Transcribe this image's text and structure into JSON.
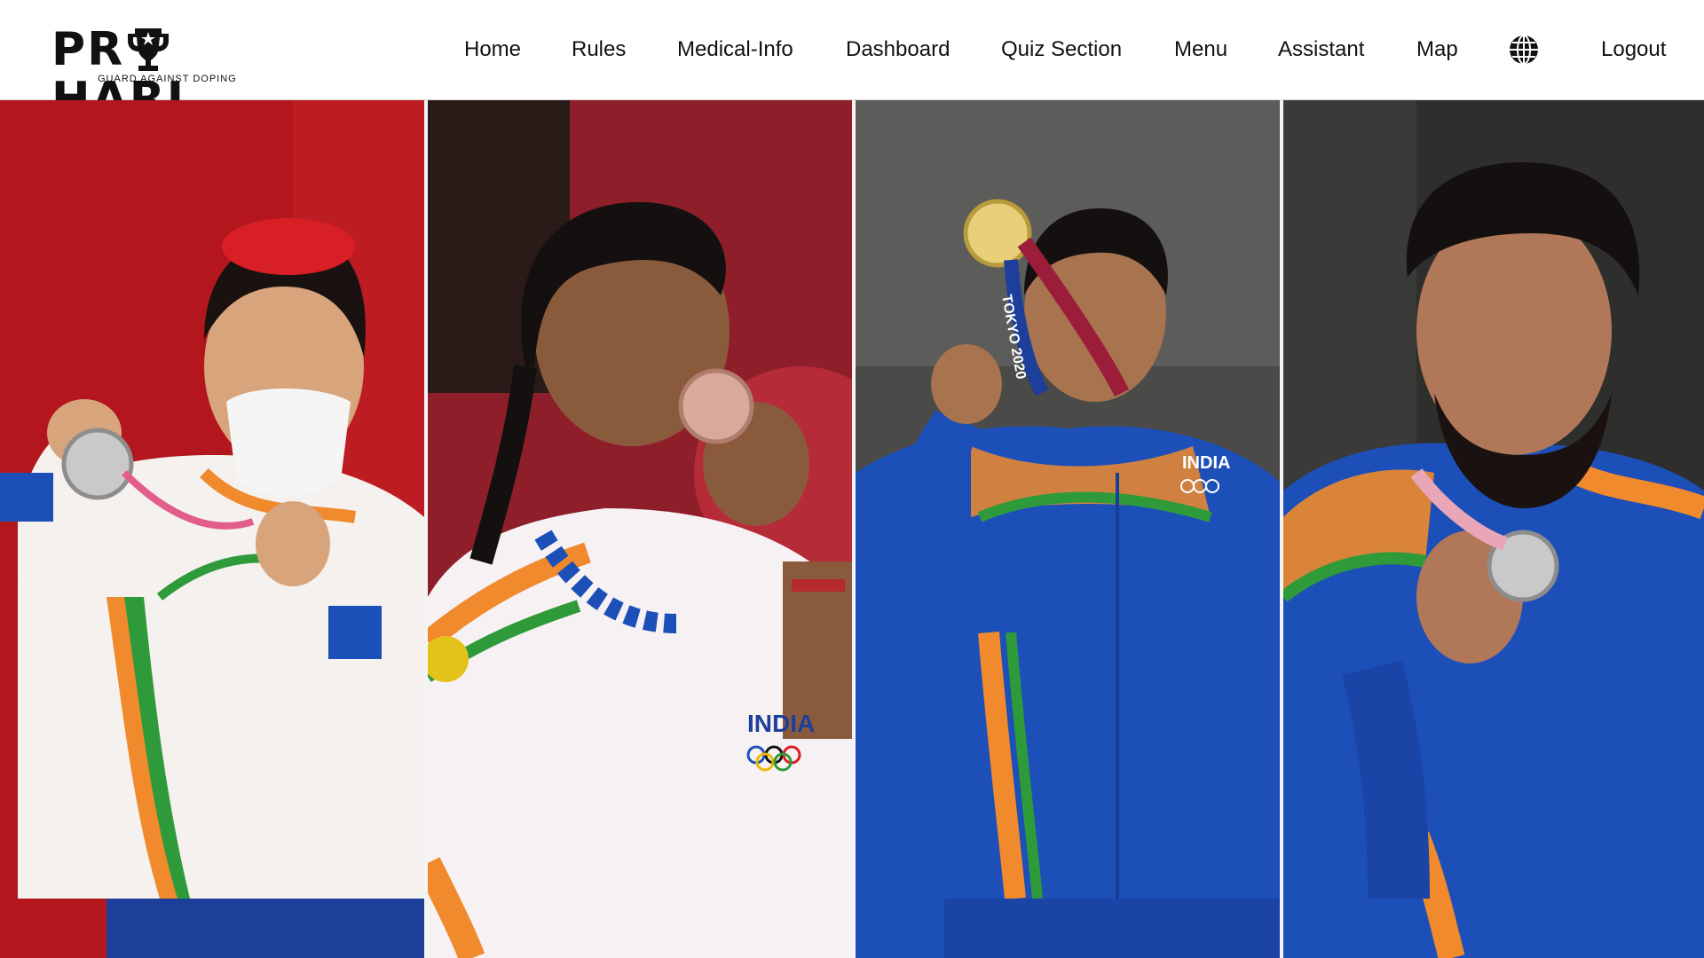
{
  "brand": {
    "name_left": "PR",
    "name_right": "HARI",
    "tagline": "GUARD AGAINST DOPING"
  },
  "nav": {
    "items": [
      {
        "label": "Home"
      },
      {
        "label": "Rules"
      },
      {
        "label": "Medical-Info"
      },
      {
        "label": "Dashboard"
      },
      {
        "label": "Quiz Section"
      },
      {
        "label": "Menu"
      },
      {
        "label": "Assistant"
      },
      {
        "label": "Map"
      }
    ],
    "language_icon": "globe-icon",
    "logout_label": "Logout"
  },
  "hero": {
    "panels": [
      {
        "subject": "weightlifter-silver-medal",
        "jacket_text": "",
        "bg": "#b3171d"
      },
      {
        "subject": "badminton-bronze-medal",
        "jacket_text": "INDIA",
        "bg": "#8e1f2a"
      },
      {
        "subject": "javelin-gold-medal",
        "jacket_text": "INDIA",
        "bg": "#4a4a48"
      },
      {
        "subject": "wrestler-silver-medal",
        "jacket_text": "",
        "bg": "#2e2e2c"
      }
    ],
    "lanyard_text": "TOKYO 2020"
  },
  "colors": {
    "saffron": "#f08a2c",
    "green": "#2f9a3a",
    "india_blue": "#1d4fb8",
    "white_jacket": "#f4f1ee",
    "text": "#111111"
  }
}
